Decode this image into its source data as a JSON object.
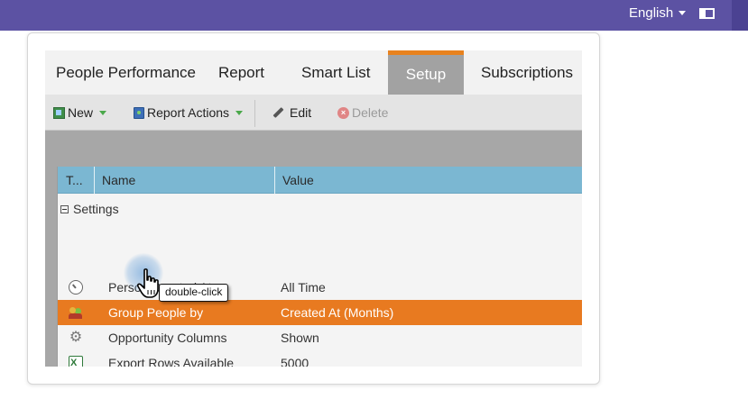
{
  "topbar": {
    "language": "English",
    "colors": {
      "bar": "#5c52a3"
    }
  },
  "tabs": [
    {
      "label": "People Performance",
      "active": false
    },
    {
      "label": "Report",
      "active": false
    },
    {
      "label": "Smart List",
      "active": false
    },
    {
      "label": "Setup",
      "active": true
    },
    {
      "label": "Subscriptions",
      "active": false
    }
  ],
  "toolbar": {
    "new_label": "New",
    "report_actions_label": "Report Actions",
    "edit_label": "Edit",
    "delete_label": "Delete"
  },
  "grid": {
    "columns": [
      "T...",
      "Name",
      "Value"
    ],
    "group_label": "Settings",
    "rows": [
      {
        "icon": "clock-icon",
        "name": "Person Created At",
        "value": "All Time",
        "selected": false
      },
      {
        "icon": "people-icon",
        "name": "Group People by",
        "value": "Created At (Months)",
        "selected": true
      },
      {
        "icon": "gear-icon",
        "name": "Opportunity Columns",
        "value": "Shown",
        "selected": false
      },
      {
        "icon": "excel-icon",
        "name": "Export Rows Available",
        "value": "5000",
        "selected": false
      }
    ]
  },
  "cursor": {
    "tooltip": "double-click"
  },
  "colors": {
    "accent": "#e87a20",
    "header": "#7bb7d2"
  }
}
